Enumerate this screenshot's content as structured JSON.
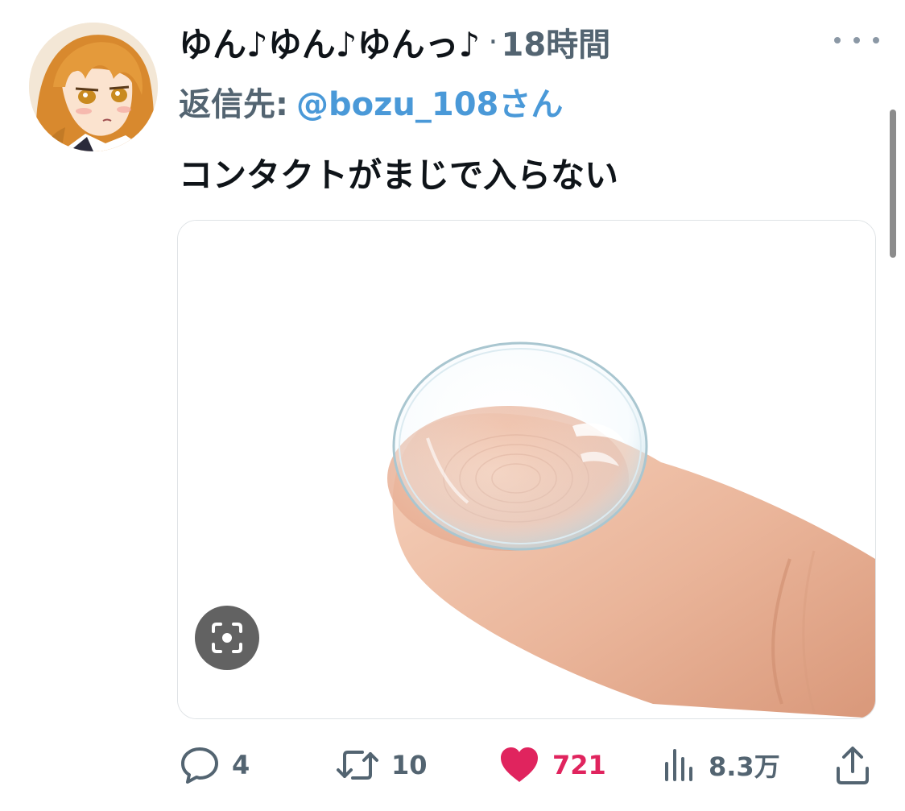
{
  "tweet": {
    "author": {
      "display_name": "ゆん♪ゆん♪ゆんっ♪",
      "separator": "·",
      "timestamp": "18時間"
    },
    "reply": {
      "prefix": "返信先:",
      "handle": "@bozu_108さん"
    },
    "text": "コンタクトがまじで入らない",
    "actions": {
      "reply_count": "4",
      "retweet_count": "10",
      "like_count": "721",
      "views_count": "8.3万"
    },
    "icons": {
      "more": "more-dots-icon",
      "reply": "reply-bubble-icon",
      "retweet": "retweet-icon",
      "like": "heart-icon",
      "views": "analytics-bars-icon",
      "share": "share-upload-icon",
      "lens": "lens-scan-icon"
    },
    "colors": {
      "handle": "#4a99d8",
      "like": "#e0245e",
      "muted": "#536471"
    }
  }
}
